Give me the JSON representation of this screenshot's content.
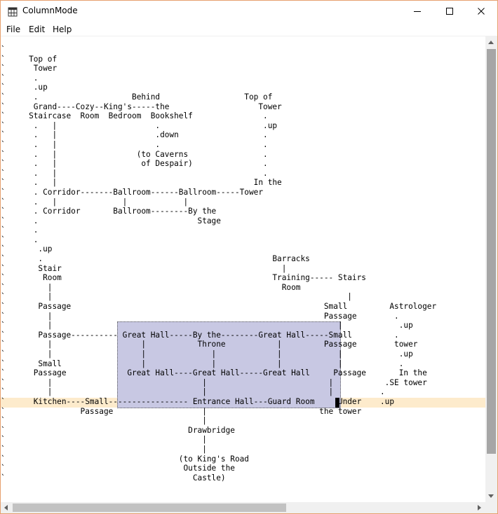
{
  "window": {
    "title": "ColumnMode",
    "icon": "app-grid-icon",
    "controls": [
      "minimize-icon",
      "maximize-icon",
      "close-icon"
    ]
  },
  "menu": {
    "file": "File",
    "edit": "Edit",
    "help": "Help"
  },
  "editor": {
    "content": "`\n`     Top of\n`      Tower\n`      .\n`      .up\n`      .                    Behind                  Top of\n`      Grand----Cozy--King's-----the                   Tower\n`     Staircase  Room  Bedroom  Bookshelf               .\n`      .   |                     .                      .up\n`      .   |                     .down                  .\n`      .   |                     .                      .\n`      .   |                 (to Caverns                .\n`      .   |                  of Despair)               .\n`      .   |                                            .\n`      .   |                                          In the\n`      . Corridor-------Ballroom------Ballroom-----Tower\n`      .   |              |            |\n`      . Corridor       Ballroom--------By the\n`      .                                  Stage\n`      .\n`      .\n`       .up\n`       .                                                 Barracks\n`       Stair                                               |\n`        Room                                             Training----- Stairs\n`         |                                                 Room\n`         |                                                               |\n`       Passage                                                      Small         Astrologer\n`         |                                                          Passage        .\n`         |                                                             |            .up\n`       Passage---------- Great Hall-----By the--------Great Hall-----Small         .\n`         |                   |           Throne           |         Passage        tower\n`         |                   |              |             |            |            .up\n`       Small                 |              |             |            |            .\n`      Passage             Great Hall----Great Hall-----Great Hall     Passage       In the\n`         |                                |                          |           .SE tower\n`         |                                |                          |          .\n`      Kitchen----Small----------------- Entrance Hall---Guard Room     Under    .up\n`                Passage                   |                        the tower\n`                                          |\n`                                       Drawbridge\n`                                          |\n`                                          |\n`                                     (to King's Road\n`                                      Outside the\n`                                        Castle)"
  },
  "colors": {
    "window_border": "#e6a06e",
    "selection": "#c8c8e3",
    "current_line": "#fdebcc",
    "scroll_thumb": "#a6a6a6"
  }
}
